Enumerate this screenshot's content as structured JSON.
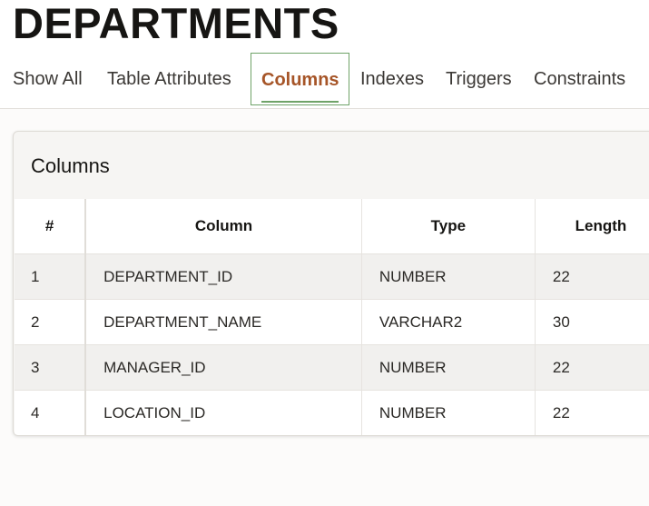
{
  "page_title": "DEPARTMENTS",
  "tabs": [
    {
      "label": "Show All"
    },
    {
      "label": "Table Attributes"
    },
    {
      "label": "Columns"
    },
    {
      "label": "Indexes"
    },
    {
      "label": "Triggers"
    },
    {
      "label": "Constraints"
    }
  ],
  "active_tab": "Columns",
  "card": {
    "title": "Columns",
    "headers": [
      "#",
      "Column",
      "Type",
      "Length"
    ],
    "rows": [
      {
        "num": "1",
        "column": "DEPARTMENT_ID",
        "type": "NUMBER",
        "length": "22"
      },
      {
        "num": "2",
        "column": "DEPARTMENT_NAME",
        "type": "VARCHAR2",
        "length": "30"
      },
      {
        "num": "3",
        "column": "MANAGER_ID",
        "type": "NUMBER",
        "length": "22"
      },
      {
        "num": "4",
        "column": "LOCATION_ID",
        "type": "NUMBER",
        "length": "22"
      }
    ]
  },
  "colors": {
    "active_tab_text": "#a65528",
    "active_tab_border": "#6fa368"
  }
}
